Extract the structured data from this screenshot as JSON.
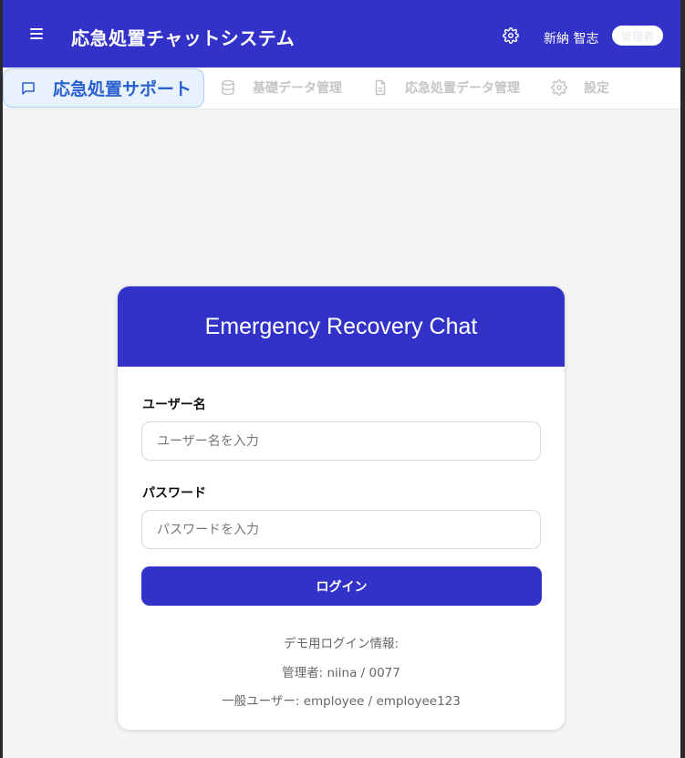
{
  "header": {
    "app_title": "応急処置チャットシステム",
    "user_name": "新納 智志",
    "role_badge": "管理者",
    "icons": {
      "menu": "hamburger-icon",
      "settings": "gear-icon"
    }
  },
  "tabs": [
    {
      "label": "応急処置サポート",
      "icon": "chat-icon",
      "active": true
    },
    {
      "label": "基礎データ管理",
      "icon": "database-icon",
      "active": false
    },
    {
      "label": "応急処置データ管理",
      "icon": "document-icon",
      "active": false
    },
    {
      "label": "設定",
      "icon": "gear-icon",
      "active": false
    }
  ],
  "login": {
    "title": "Emergency Recovery Chat",
    "username_label": "ユーザー名",
    "username_placeholder": "ユーザー名を入力",
    "username_value": "",
    "password_label": "パスワード",
    "password_placeholder": "パスワードを入力",
    "password_value": "",
    "submit_label": "ログイン",
    "demo_title": "デモ用ログイン情報:",
    "demo_admin": "管理者: niina / 0077",
    "demo_user": "一般ユーザー: employee / employee123"
  },
  "colors": {
    "primary": "#3232c8",
    "active_tab_bg": "#e8f2fd",
    "active_tab_text": "#2a5fd0",
    "inactive_tab_text": "#c5c5c5",
    "page_bg": "#f4f4f4"
  }
}
